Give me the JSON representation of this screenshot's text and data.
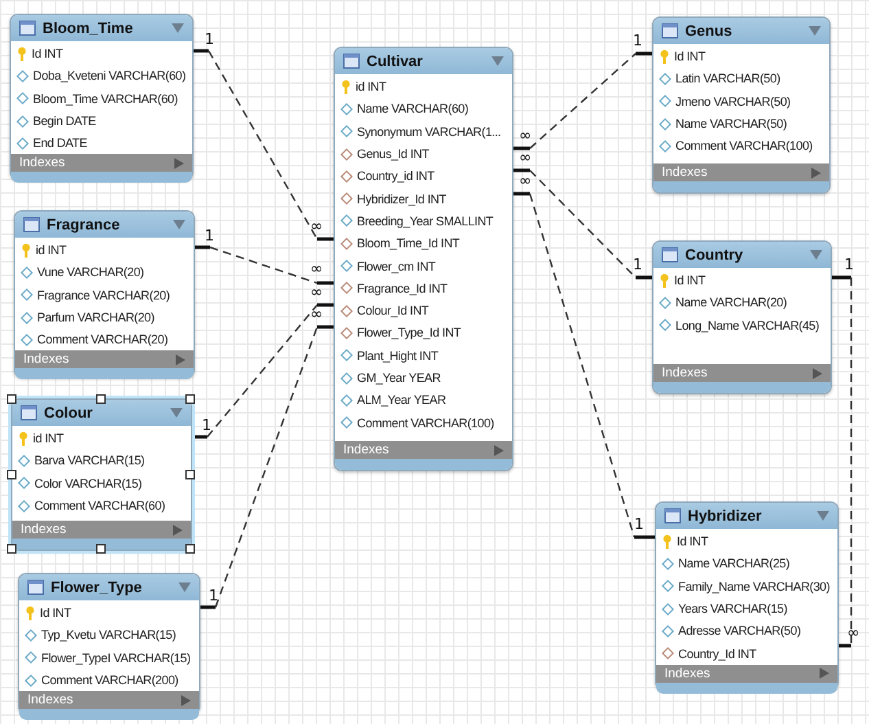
{
  "tables": [
    {
      "name": "Bloom_Time",
      "selected": false,
      "footer": "Indexes",
      "columns": [
        {
          "text": "Id INT",
          "kind": "pk"
        },
        {
          "text": "Doba_Kveteni VARCHAR(60)",
          "kind": "attr"
        },
        {
          "text": "Bloom_Time VARCHAR(60)",
          "kind": "attr"
        },
        {
          "text": "Begin DATE",
          "kind": "attr"
        },
        {
          "text": "End DATE",
          "kind": "attr"
        }
      ]
    },
    {
      "name": "Fragrance",
      "selected": false,
      "footer": "Indexes",
      "columns": [
        {
          "text": "id INT",
          "kind": "pk"
        },
        {
          "text": "Vune VARCHAR(20)",
          "kind": "attr"
        },
        {
          "text": "Fragrance VARCHAR(20)",
          "kind": "attr"
        },
        {
          "text": "Parfum VARCHAR(20)",
          "kind": "attr"
        },
        {
          "text": "Comment VARCHAR(20)",
          "kind": "attr"
        }
      ]
    },
    {
      "name": "Colour",
      "selected": true,
      "footer": "Indexes",
      "columns": [
        {
          "text": "id INT",
          "kind": "pk"
        },
        {
          "text": "Barva VARCHAR(15)",
          "kind": "attr"
        },
        {
          "text": "Color VARCHAR(15)",
          "kind": "attr"
        },
        {
          "text": "Comment VARCHAR(60)",
          "kind": "attr"
        }
      ]
    },
    {
      "name": "Flower_Type",
      "selected": false,
      "footer": "Indexes",
      "columns": [
        {
          "text": "Id INT",
          "kind": "pk"
        },
        {
          "text": "Typ_Kvetu VARCHAR(15)",
          "kind": "attr"
        },
        {
          "text": "Flower_TypeI VARCHAR(15)",
          "kind": "attr"
        },
        {
          "text": "Comment VARCHAR(200)",
          "kind": "attr"
        }
      ]
    },
    {
      "name": "Cultivar",
      "selected": false,
      "footer": "Indexes",
      "columns": [
        {
          "text": "id INT",
          "kind": "pk"
        },
        {
          "text": "Name VARCHAR(60)",
          "kind": "attr"
        },
        {
          "text": "Synonymum VARCHAR(1...",
          "kind": "attr"
        },
        {
          "text": "Genus_Id INT",
          "kind": "fk"
        },
        {
          "text": "Country_id INT",
          "kind": "fk"
        },
        {
          "text": "Hybridizer_Id INT",
          "kind": "fk"
        },
        {
          "text": "Breeding_Year SMALLINT",
          "kind": "attr"
        },
        {
          "text": "Bloom_Time_Id INT",
          "kind": "fk"
        },
        {
          "text": "Flower_cm INT",
          "kind": "attr"
        },
        {
          "text": "Fragrance_Id INT",
          "kind": "fk"
        },
        {
          "text": "Colour_Id INT",
          "kind": "fk"
        },
        {
          "text": "Flower_Type_Id INT",
          "kind": "fk"
        },
        {
          "text": "Plant_Hight INT",
          "kind": "attr"
        },
        {
          "text": "GM_Year YEAR",
          "kind": "attr"
        },
        {
          "text": "ALM_Year YEAR",
          "kind": "attr"
        },
        {
          "text": "Comment VARCHAR(100)",
          "kind": "attr"
        }
      ]
    },
    {
      "name": "Genus",
      "selected": false,
      "footer": "Indexes",
      "columns": [
        {
          "text": "Id INT",
          "kind": "pk"
        },
        {
          "text": "Latin VARCHAR(50)",
          "kind": "attr"
        },
        {
          "text": "Jmeno VARCHAR(50)",
          "kind": "attr"
        },
        {
          "text": "Name VARCHAR(50)",
          "kind": "attr"
        },
        {
          "text": "Comment VARCHAR(100)",
          "kind": "attr"
        }
      ]
    },
    {
      "name": "Country",
      "selected": false,
      "footer": "Indexes",
      "columns": [
        {
          "text": "Id INT",
          "kind": "pk"
        },
        {
          "text": "Name VARCHAR(20)",
          "kind": "attr"
        },
        {
          "text": "Long_Name VARCHAR(45)",
          "kind": "attr"
        }
      ]
    },
    {
      "name": "Hybridizer",
      "selected": false,
      "footer": "Indexes",
      "columns": [
        {
          "text": "Id INT",
          "kind": "pk"
        },
        {
          "text": "Name VARCHAR(25)",
          "kind": "attr"
        },
        {
          "text": "Family_Name VARCHAR(30)",
          "kind": "attr"
        },
        {
          "text": "Years VARCHAR(15)",
          "kind": "attr"
        },
        {
          "text": "Adresse VARCHAR(50)",
          "kind": "attr"
        },
        {
          "text": "Country_Id INT",
          "kind": "fk"
        }
      ]
    }
  ],
  "relationships": [
    {
      "one": "1",
      "many": "∞"
    },
    {
      "one": "1",
      "many": "∞"
    },
    {
      "one": "1",
      "many": "∞"
    },
    {
      "one": "1",
      "many": "∞"
    },
    {
      "one": "1",
      "many": "∞"
    },
    {
      "one": "1",
      "many": "∞"
    },
    {
      "one": "1",
      "many": "∞"
    },
    {
      "one": "1",
      "many": "∞"
    }
  ]
}
